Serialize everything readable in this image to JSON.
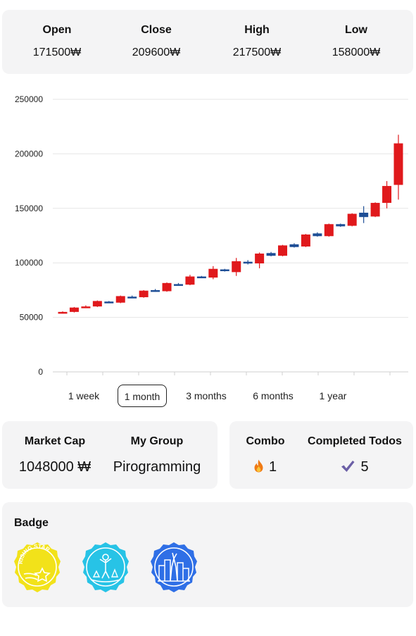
{
  "ohlc": {
    "open": {
      "label": "Open",
      "value": "171500₩"
    },
    "close": {
      "label": "Close",
      "value": "209600₩"
    },
    "high": {
      "label": "High",
      "value": "217500₩"
    },
    "low": {
      "label": "Low",
      "value": "158000₩"
    }
  },
  "ranges": [
    {
      "label": "1 week"
    },
    {
      "label": "1 month",
      "active": true
    },
    {
      "label": "3 months"
    },
    {
      "label": "6 months"
    },
    {
      "label": "1 year"
    }
  ],
  "stats": {
    "market_cap": {
      "label": "Market Cap",
      "value": "1048000 ₩"
    },
    "group": {
      "label": "My Group",
      "value": "Pirogramming"
    },
    "combo": {
      "label": "Combo",
      "value": "1",
      "icon": "flame-icon"
    },
    "todos": {
      "label": "Completed Todos",
      "value": "5",
      "icon": "checkmark-icon"
    }
  },
  "badges": {
    "title": "Badge",
    "items": [
      {
        "icon": "rising-star-badge-icon",
        "text": "RISING STAR",
        "color": "#f2e21a"
      },
      {
        "icon": "nature-badge-icon",
        "color": "#27c3e6"
      },
      {
        "icon": "city-badge-icon",
        "color": "#2f6fe6"
      }
    ]
  },
  "colors": {
    "up": "#e0191c",
    "down": "#1e4e96",
    "card": "#f4f4f5"
  },
  "chart_data": {
    "type": "candlestick",
    "ylim": [
      0,
      250000
    ],
    "yticks": [
      "0",
      "50000",
      "100000",
      "150000",
      "200000",
      "250000"
    ],
    "grid": "horizontal",
    "candles": [
      {
        "o": 54000,
        "c": 55000,
        "h": 55500,
        "l": 53500
      },
      {
        "o": 55000,
        "c": 59000,
        "h": 59500,
        "l": 54500
      },
      {
        "o": 59000,
        "c": 60000,
        "h": 61000,
        "l": 58500
      },
      {
        "o": 60000,
        "c": 65000,
        "h": 65500,
        "l": 59500
      },
      {
        "o": 64500,
        "c": 63500,
        "h": 65000,
        "l": 63000
      },
      {
        "o": 63500,
        "c": 69500,
        "h": 70000,
        "l": 63000
      },
      {
        "o": 69000,
        "c": 68500,
        "h": 70000,
        "l": 68000
      },
      {
        "o": 68500,
        "c": 74500,
        "h": 75000,
        "l": 68000
      },
      {
        "o": 75000,
        "c": 74000,
        "h": 76000,
        "l": 73500
      },
      {
        "o": 74000,
        "c": 81500,
        "h": 82000,
        "l": 73500
      },
      {
        "o": 80500,
        "c": 80000,
        "h": 81500,
        "l": 79500
      },
      {
        "o": 80000,
        "c": 87500,
        "h": 89000,
        "l": 79500
      },
      {
        "o": 87500,
        "c": 86500,
        "h": 88000,
        "l": 86000
      },
      {
        "o": 86500,
        "c": 94500,
        "h": 97000,
        "l": 85000
      },
      {
        "o": 94000,
        "c": 92500,
        "h": 94500,
        "l": 92000
      },
      {
        "o": 91500,
        "c": 101500,
        "h": 104500,
        "l": 88000
      },
      {
        "o": 101000,
        "c": 99500,
        "h": 102500,
        "l": 98500
      },
      {
        "o": 99500,
        "c": 108500,
        "h": 109500,
        "l": 95000
      },
      {
        "o": 109000,
        "c": 106500,
        "h": 110000,
        "l": 106000
      },
      {
        "o": 106500,
        "c": 116000,
        "h": 116500,
        "l": 106000
      },
      {
        "o": 117000,
        "c": 114500,
        "h": 118000,
        "l": 114000
      },
      {
        "o": 115000,
        "c": 126000,
        "h": 126500,
        "l": 114500
      },
      {
        "o": 127000,
        "c": 124500,
        "h": 128000,
        "l": 124000
      },
      {
        "o": 124500,
        "c": 135500,
        "h": 136000,
        "l": 124000
      },
      {
        "o": 135500,
        "c": 133500,
        "h": 136000,
        "l": 133000
      },
      {
        "o": 134000,
        "c": 145000,
        "h": 145500,
        "l": 133500
      },
      {
        "o": 146000,
        "c": 142000,
        "h": 152000,
        "l": 136500
      },
      {
        "o": 142500,
        "c": 155000,
        "h": 155500,
        "l": 142000
      },
      {
        "o": 155000,
        "c": 170500,
        "h": 175000,
        "l": 150000
      },
      {
        "o": 171500,
        "c": 209600,
        "h": 217500,
        "l": 158000
      }
    ]
  }
}
